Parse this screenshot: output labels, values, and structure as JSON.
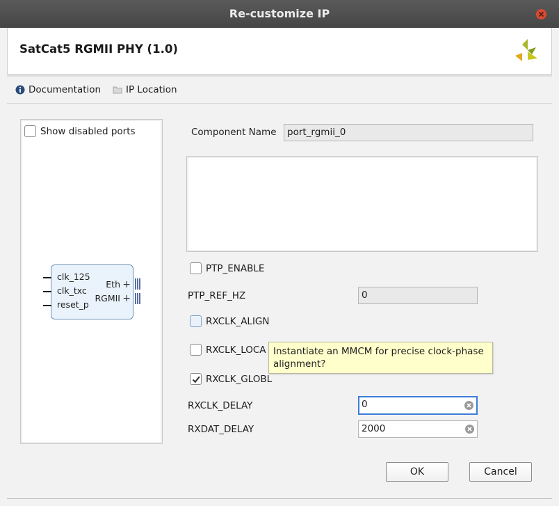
{
  "window": {
    "title": "Re-customize IP"
  },
  "header": {
    "title": "SatCat5 RGMII PHY (1.0)"
  },
  "links": {
    "documentation": "Documentation",
    "ip_location": "IP Location"
  },
  "left_panel": {
    "show_disabled_ports": "Show disabled ports",
    "block": {
      "inputs": [
        "clk_125",
        "clk_txc",
        "reset_p"
      ],
      "outputs": [
        "Eth",
        "RGMII"
      ]
    }
  },
  "form": {
    "component_name_label": "Component Name",
    "component_name_value": "port_rgmii_0",
    "ptp_enable_label": "PTP_ENABLE",
    "ptp_ref_hz_label": "PTP_REF_HZ",
    "ptp_ref_hz_value": "0",
    "rxclk_align_label": "RXCLK_ALIGN",
    "rxclk_local_label": "RXCLK_LOCA",
    "rxclk_global_label": "RXCLK_GLOBL",
    "rxclk_delay_label": "RXCLK_DELAY",
    "rxclk_delay_value": "0",
    "rxdat_delay_label": "RXDAT_DELAY",
    "rxdat_delay_value": "2000",
    "tooltip": "Instantiate an MMCM for precise clock-phase alignment?"
  },
  "buttons": {
    "ok": "OK",
    "cancel": "Cancel"
  },
  "colors": {
    "titlebar": "#4f4f4f",
    "close": "#d94a32",
    "focus": "#3b7dd8",
    "tooltip_bg": "#ffffcc"
  }
}
